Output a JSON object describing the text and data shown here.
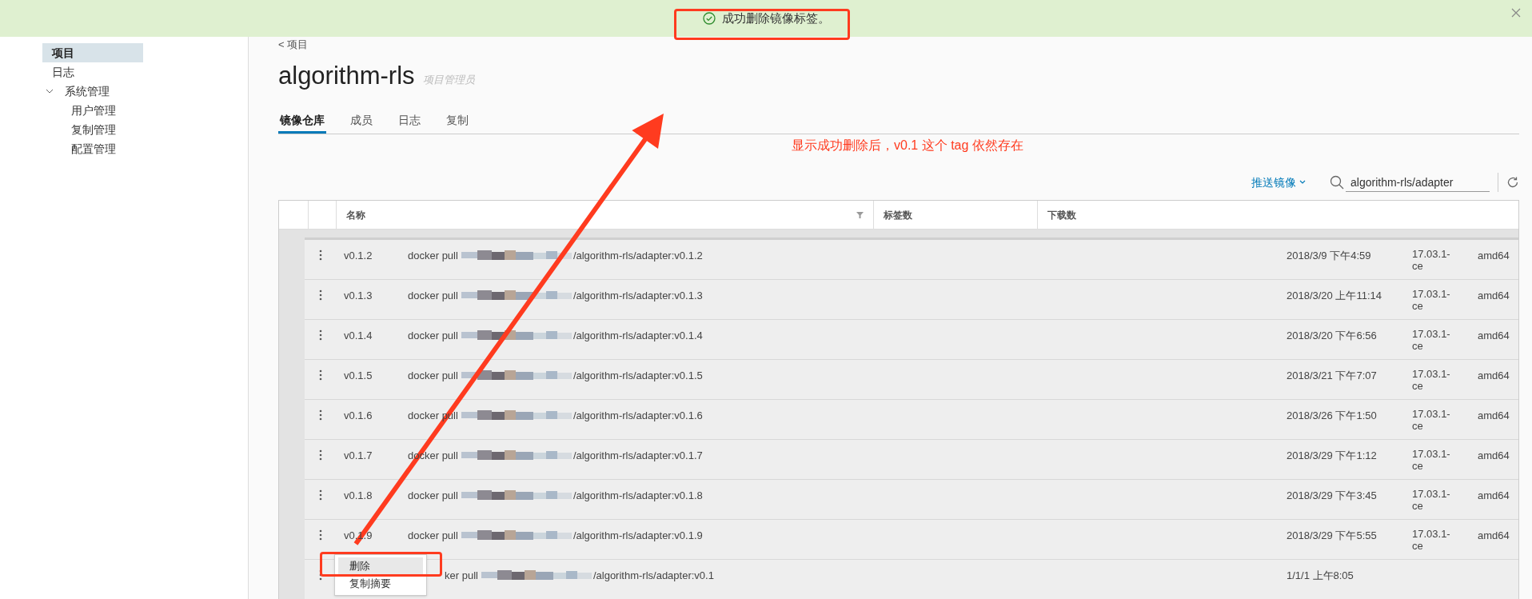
{
  "banner": {
    "message": "成功删除镜像标签。"
  },
  "sidebar": {
    "items": [
      {
        "label": "项目",
        "selected": true
      },
      {
        "label": "日志",
        "selected": false
      },
      {
        "label": "系统管理",
        "selected": false,
        "expanded": true,
        "children": [
          {
            "label": "用户管理",
            "selected": false
          },
          {
            "label": "复制管理",
            "selected": false
          },
          {
            "label": "配置管理",
            "selected": false
          }
        ]
      }
    ]
  },
  "back_link": "< 项目",
  "project": {
    "title": "algorithm-rls",
    "role": "项目管理员"
  },
  "tabs": [
    {
      "label": "镜像仓库",
      "selected": true
    },
    {
      "label": "成员",
      "selected": false
    },
    {
      "label": "日志",
      "selected": false
    },
    {
      "label": "复制",
      "selected": false
    }
  ],
  "annotation": {
    "note": "显示成功删除后，v0.1 这个 tag 依然存在"
  },
  "toolbar": {
    "push_button": "推送镜像",
    "search": {
      "value": "algorithm-rls/adapter"
    }
  },
  "table": {
    "columns": [
      "名称",
      "标签数",
      "下载数"
    ],
    "rows": [
      {
        "tag": "v0.1.2",
        "pull_prefix": "docker pull",
        "pull_suffix": "/algorithm-rls/adapter:v0.1.2",
        "created": "2018/3/9 下午4:59",
        "docker_version": "17.03.1-ce",
        "arch": "amd64"
      },
      {
        "tag": "v0.1.3",
        "pull_prefix": "docker pull",
        "pull_suffix": "/algorithm-rls/adapter:v0.1.3",
        "created": "2018/3/20 上午11:14",
        "docker_version": "17.03.1-ce",
        "arch": "amd64"
      },
      {
        "tag": "v0.1.4",
        "pull_prefix": "docker pull",
        "pull_suffix": "/algorithm-rls/adapter:v0.1.4",
        "created": "2018/3/20 下午6:56",
        "docker_version": "17.03.1-ce",
        "arch": "amd64"
      },
      {
        "tag": "v0.1.5",
        "pull_prefix": "docker pull",
        "pull_suffix": "/algorithm-rls/adapter:v0.1.5",
        "created": "2018/3/21 下午7:07",
        "docker_version": "17.03.1-ce",
        "arch": "amd64"
      },
      {
        "tag": "v0.1.6",
        "pull_prefix": "docker pull",
        "pull_suffix": "/algorithm-rls/adapter:v0.1.6",
        "created": "2018/3/26 下午1:50",
        "docker_version": "17.03.1-ce",
        "arch": "amd64"
      },
      {
        "tag": "v0.1.7",
        "pull_prefix": "docker pull",
        "pull_suffix": "/algorithm-rls/adapter:v0.1.7",
        "created": "2018/3/29 下午1:12",
        "docker_version": "17.03.1-ce",
        "arch": "amd64"
      },
      {
        "tag": "v0.1.8",
        "pull_prefix": "docker pull",
        "pull_suffix": "/algorithm-rls/adapter:v0.1.8",
        "created": "2018/3/29 下午3:45",
        "docker_version": "17.03.1-ce",
        "arch": "amd64"
      },
      {
        "tag": "v0.1.9",
        "pull_prefix": "docker pull",
        "pull_suffix": "/algorithm-rls/adapter:v0.1.9",
        "created": "2018/3/29 下午5:55",
        "docker_version": "17.03.1-ce",
        "arch": "amd64"
      },
      {
        "pull_prefix": "ker pull",
        "pull_suffix": "/algorithm-rls/adapter:v0.1",
        "created": "1/1/1 上午8:05"
      }
    ]
  },
  "context_menu": {
    "items": [
      {
        "label": "删除",
        "selected": true
      },
      {
        "label": "复制摘要",
        "selected": false
      }
    ]
  }
}
